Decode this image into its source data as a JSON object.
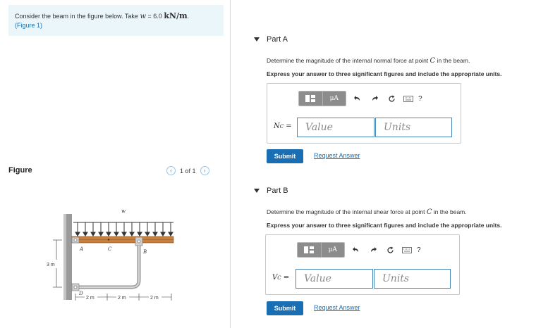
{
  "problem": {
    "intro": "Consider the beam in the figure below. Take",
    "variable": "w",
    "equals": " = 6.0 ",
    "unit": "kN/m",
    "period": ".",
    "figure_link": "(Figure 1)"
  },
  "figure_panel": {
    "header": "Figure",
    "pager_text": "1 of 1",
    "prev_icon": "chevron-left-icon",
    "next_icon": "chevron-right-icon",
    "labels": {
      "w": "w",
      "a": "A",
      "c": "C",
      "b": "B",
      "d": "D",
      "height": "3 m",
      "span1": "2 m",
      "span2": "2 m",
      "span3": "2 m"
    },
    "colors": {
      "beam": "#c8803c",
      "support": "#9a9a9a"
    }
  },
  "parts": [
    {
      "title": "Part A",
      "question_prefix": "Determine the magnitude of the internal normal force at point ",
      "point": "C",
      "question_suffix": " in the beam.",
      "instruction": "Express your answer to three significant figures and include the appropriate units.",
      "var_main": "N",
      "var_sub": "C",
      "equals": " =",
      "value_placeholder": "Value",
      "units_placeholder": "Units",
      "submit_label": "Submit",
      "request_label": "Request Answer"
    },
    {
      "title": "Part B",
      "question_prefix": "Determine the magnitude of the internal shear force at point ",
      "point": "C",
      "question_suffix": " in the beam.",
      "instruction": "Express your answer to three significant figures and include the appropriate units.",
      "var_main": "V",
      "var_sub": "C",
      "equals": " =",
      "value_placeholder": "Value",
      "units_placeholder": "Units",
      "submit_label": "Submit",
      "request_label": "Request Answer"
    }
  ],
  "toolbar": {
    "template_icon": "template-icon",
    "units_button": "μA",
    "undo_icon": "undo-icon",
    "redo_icon": "redo-icon",
    "reset_icon": "reset-icon",
    "keyboard_icon": "keyboard-icon",
    "help_label": "?"
  },
  "colors": {
    "accent": "#1a6eb4",
    "problem_bg": "#eaf6f9",
    "input_border": "#4a86b4",
    "toolbar_gray": "#8c8c8c"
  }
}
